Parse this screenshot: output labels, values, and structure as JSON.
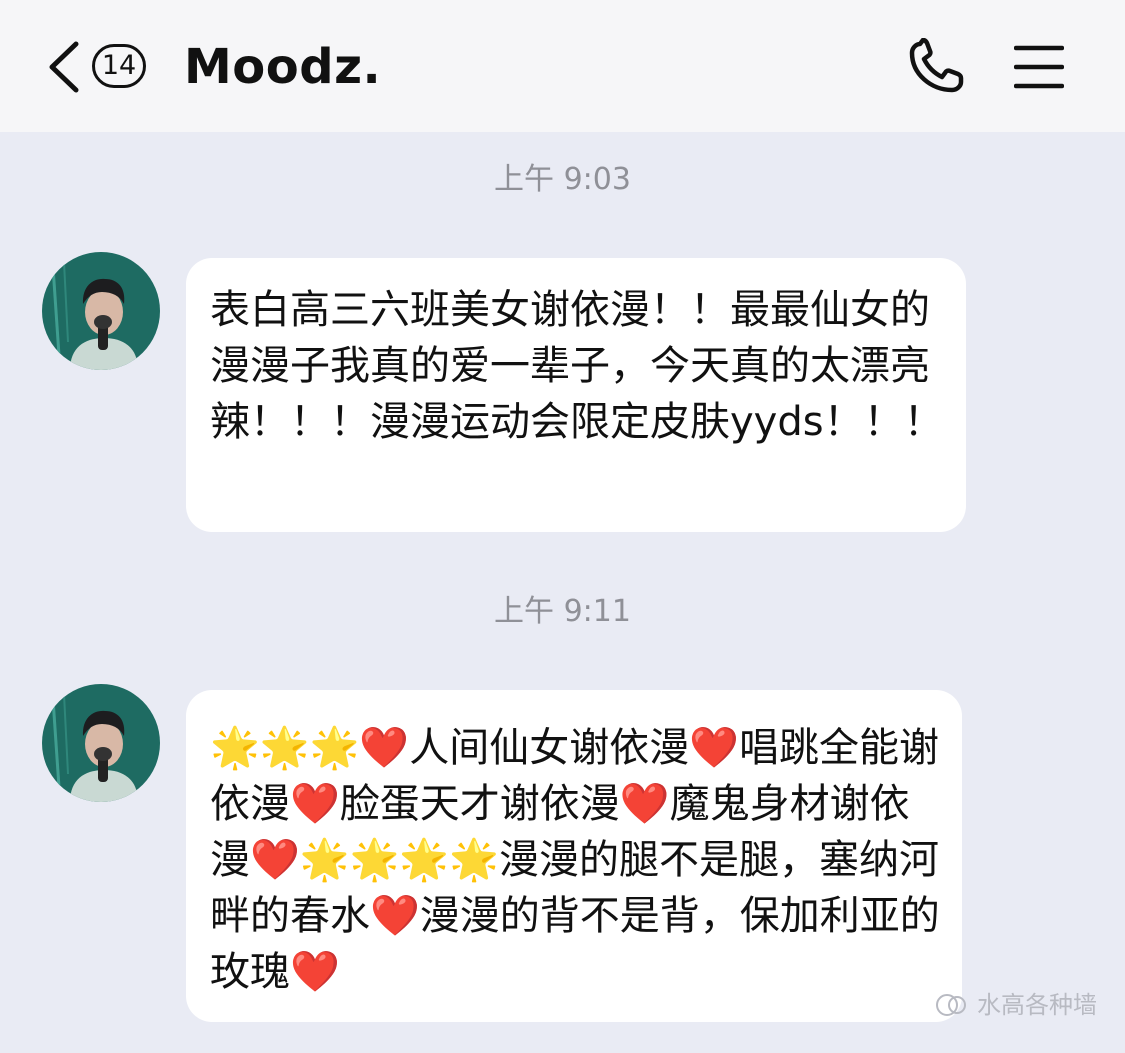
{
  "header": {
    "unread_count": "14",
    "title": "Moodz."
  },
  "messages": [
    {
      "time": "上午 9:03",
      "text": "表白高三六班美女谢依漫！！最最仙女的漫漫子我真的爱一辈子，今天真的太漂亮辣！！！漫漫运动会限定皮肤yyds！！！"
    },
    {
      "time": "上午 9:11",
      "text": "🌟🌟🌟❤️人间仙女谢依漫❤️唱跳全能谢依漫❤️脸蛋天才谢依漫❤️魔鬼身材谢依漫❤️🌟🌟🌟🌟漫漫的腿不是腿，塞纳河畔的春水❤️漫漫的背不是背，保加利亚的玫瑰❤️"
    }
  ],
  "watermark": "水高各种墙",
  "colors": {
    "background": "#e9ebf4",
    "header": "#f6f6f8",
    "bubble": "#ffffff",
    "timestamp": "#8f9097"
  }
}
